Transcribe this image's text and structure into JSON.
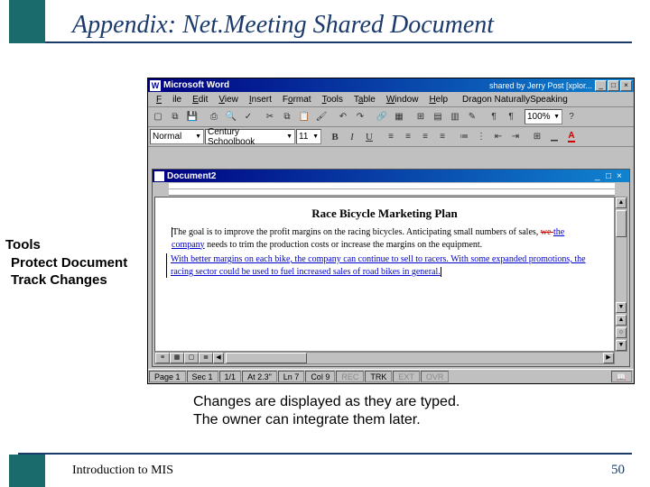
{
  "slide": {
    "title": "Appendix: Net.Meeting Shared Document",
    "caption_line1": "Changes are displayed as they are typed.",
    "caption_line2": "The owner can integrate them later.",
    "footer": "Introduction to MIS",
    "page_number": "50"
  },
  "sidebar": {
    "heading": "Tools",
    "item1": "Protect Document",
    "item2": "Track Changes"
  },
  "word": {
    "app_title": "Microsoft Word",
    "shared_by": "shared by Jerry Post [xplor...",
    "app_icon_letter": "W",
    "win_min": "_",
    "win_max": "□",
    "win_close": "×",
    "menu": {
      "file": "File",
      "edit": "Edit",
      "view": "View",
      "insert": "Insert",
      "format": "Format",
      "tools": "Tools",
      "table": "Table",
      "window": "Window",
      "help": "Help",
      "dragon": "Dragon NaturallySpeaking"
    },
    "toolbar1": {
      "zoom": "100%"
    },
    "toolbar2": {
      "style": "Normal",
      "font": "Century Schoolbook",
      "size": "11",
      "bold": "B",
      "italic": "I",
      "underline": "U",
      "font_color": "A"
    },
    "doc": {
      "title": "Document2",
      "heading": "Race Bicycle Marketing Plan",
      "para1a": "The goal is to improve the profit margins on the racing bicycles. Anticipating small numbers of sales, ",
      "para1_del": "we ",
      "para1_ins": "the company",
      "para1b": " needs to trim the production costs or increase the margins on the equipment.",
      "para2": "With better margins on each bike, the company can continue to sell to racers. With some expanded promotions, the racing sector could be used to fuel increased sales of road bikes in general."
    },
    "status": {
      "page": "Page 1",
      "sec": "Sec 1",
      "pages": "1/1",
      "at": "At 2.3\"",
      "ln": "Ln 7",
      "col": "Col 9",
      "rec": "REC",
      "trk": "TRK",
      "ext": "EXT",
      "ovr": "OVR"
    }
  }
}
